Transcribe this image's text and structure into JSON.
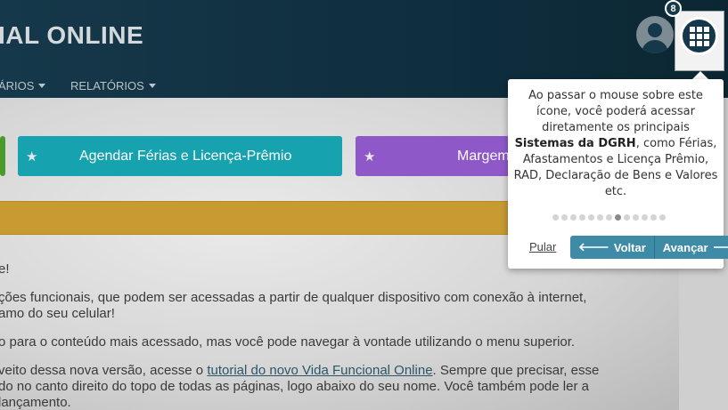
{
  "header": {
    "app_title": "IAL ONLINE",
    "nav": [
      {
        "label": "ÁRIOS"
      },
      {
        "label": "RELATÓRIOS"
      }
    ],
    "tour_step_badge": "8"
  },
  "cards": [
    {
      "label": ""
    },
    {
      "label": "Agendar Férias e Licença-Prêmio"
    },
    {
      "label": "Margem"
    }
  ],
  "content": {
    "line1": "e!",
    "line2": "ções funcionais, que podem ser acessadas a partir de qualquer dispositivo com conexão à internet,",
    "line3": "amo do seu celular!",
    "line4": "o para o conteúdo mais acessado, mas você pode navegar à vontade utilizando o menu superior.",
    "line5_prefix": "veito dessa nova versão, acesse o ",
    "line5_link": "tutorial do novo Vida Funcional Online",
    "line5_suffix": ". Sempre que precisar, esse",
    "line6": "do no canto direito do topo de todas as páginas, logo abaixo do seu nome. Você também pode ler a",
    "line7": "lançamento."
  },
  "popover": {
    "text_before": "Ao passar o mouse sobre este ícone, você poderá acessar diretamente os principais",
    "text_bold": "Sistemas da DGRH",
    "text_after": ", como Férias, Afastamentos e Licença Prêmio, RAD, Declaração de Bens e Valores etc.",
    "total_steps": 13,
    "current_step": 8,
    "skip_label": "Pular",
    "back_label": "Voltar",
    "next_label": "Avançar"
  }
}
